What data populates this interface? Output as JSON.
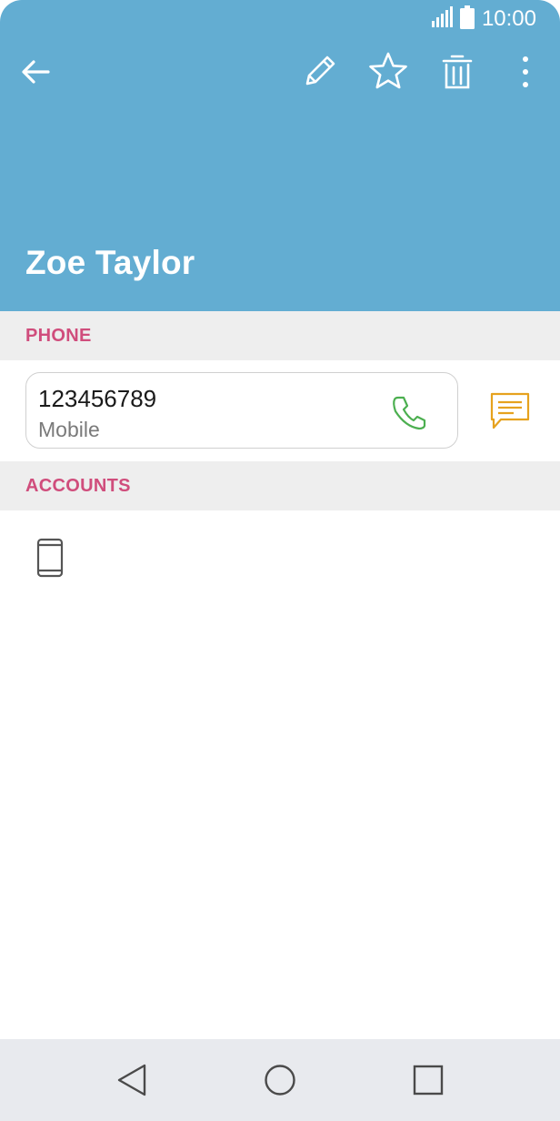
{
  "status_bar": {
    "time": "10:00",
    "icons": [
      "signal-icon",
      "battery-icon"
    ]
  },
  "toolbar": {
    "icons": [
      "back-arrow-icon",
      "edit-pencil-icon",
      "favorite-star-icon",
      "delete-trash-icon",
      "more-options-icon"
    ]
  },
  "contact": {
    "name": "Zoe Taylor"
  },
  "sections": {
    "phone_title": "PHONE",
    "accounts_title": "ACCOUNTS"
  },
  "phone_entry": {
    "number": "123456789",
    "type": "Mobile",
    "call_icon": "phone-call-icon",
    "message_icon": "message-icon"
  },
  "accounts": {
    "items": [
      {
        "icon": "device-phone-icon"
      }
    ]
  },
  "navbar": {
    "icons": [
      "nav-back-icon",
      "nav-home-icon",
      "nav-recents-icon"
    ]
  },
  "colors": {
    "header_bg": "#63add2",
    "section_title": "#d04d7c",
    "call_icon": "#4caf50",
    "message_icon": "#e6a21e",
    "section_bg": "#eeeeee",
    "navbar_bg": "#e8eaee"
  }
}
